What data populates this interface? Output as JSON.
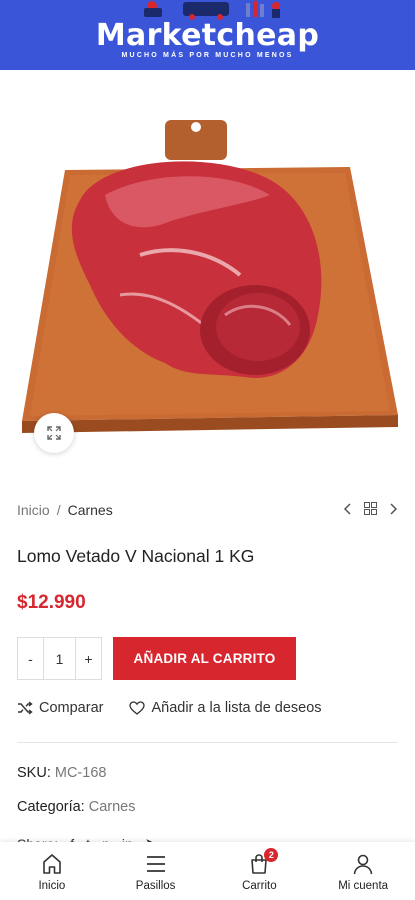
{
  "header": {
    "logo_text": "Marketcheap",
    "tagline": "MUCHO MÁS POR MUCHO MENOS",
    "background_color": "#3b55d9"
  },
  "product": {
    "image_icon": "meat-on-cutting-board",
    "zoom_icon": "expand-icon",
    "title": "Lomo Vetado V Nacional 1 KG",
    "price": "$12.990",
    "price_color": "#d8262f"
  },
  "breadcrumb": {
    "home": "Inicio",
    "separator": "/",
    "current": "Carnes"
  },
  "cart": {
    "minus_label": "-",
    "quantity": "1",
    "plus_label": "+",
    "add_label": "AÑADIR AL CARRITO",
    "button_color": "#d8262f"
  },
  "actions": {
    "compare_label": "Comparar",
    "wishlist_label": "Añadir a la lista de deseos"
  },
  "meta": {
    "sku_label": "SKU:",
    "sku_value": "MC-168",
    "category_label": "Categoría:",
    "category_value": "Carnes",
    "share_label": "Share:"
  },
  "bottom_nav": {
    "items": [
      {
        "label": "Inicio",
        "icon": "home-icon"
      },
      {
        "label": "Pasillos",
        "icon": "menu-icon"
      },
      {
        "label": "Carrito",
        "icon": "cart-icon",
        "badge": "2"
      },
      {
        "label": "Mi cuenta",
        "icon": "user-icon"
      }
    ]
  }
}
